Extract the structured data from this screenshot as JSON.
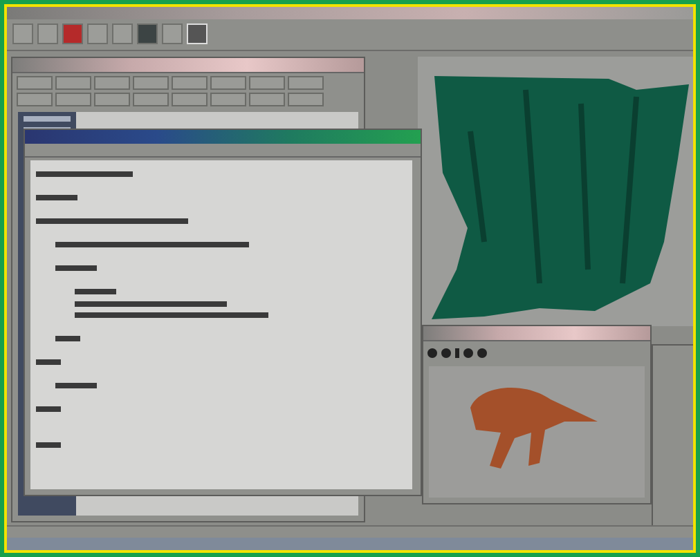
{
  "toolbar": {
    "buttons": [
      {
        "kind": "plain"
      },
      {
        "kind": "plain"
      },
      {
        "kind": "red"
      },
      {
        "kind": "plain"
      },
      {
        "kind": "plain"
      },
      {
        "kind": "dark"
      },
      {
        "kind": "plain"
      },
      {
        "kind": "boxed"
      }
    ]
  },
  "object_window": {
    "tabs": [
      {
        "kind": "tab"
      },
      {
        "kind": "tab"
      },
      {
        "kind": "tab"
      },
      {
        "kind": "tab"
      },
      {
        "kind": "tab"
      },
      {
        "kind": "tab"
      },
      {
        "kind": "tab"
      },
      {
        "kind": "tab"
      },
      {
        "kind": "tab"
      },
      {
        "kind": "tab"
      },
      {
        "kind": "tab"
      },
      {
        "kind": "tab"
      },
      {
        "kind": "tab"
      },
      {
        "kind": "tab"
      },
      {
        "kind": "tab"
      },
      {
        "kind": "tab"
      }
    ]
  },
  "script_editor": {
    "lines": [
      {
        "kind": "mid"
      },
      {
        "kind": "blank"
      },
      {
        "kind": "short"
      },
      {
        "kind": "blank"
      },
      {
        "kind": "long",
        "children": [
          {
            "kind": "blank"
          },
          {
            "kind": "xlong"
          },
          {
            "kind": "blank"
          },
          {
            "kind": "short",
            "children": [
              {
                "kind": "blank"
              },
              {
                "kind": "short"
              },
              {
                "kind": "long"
              },
              {
                "kind": "xlong"
              },
              {
                "kind": "blank"
              }
            ]
          },
          {
            "kind": "tiny"
          },
          {
            "kind": "blank"
          }
        ]
      },
      {
        "kind": "tiny",
        "children": [
          {
            "kind": "blank"
          },
          {
            "kind": "short"
          },
          {
            "kind": "blank"
          }
        ]
      },
      {
        "kind": "tiny"
      },
      {
        "kind": "blank"
      },
      {
        "kind": "blank"
      },
      {
        "kind": "tiny"
      }
    ]
  },
  "preview": {
    "buttons": [
      {
        "kind": "round"
      },
      {
        "kind": "round"
      },
      {
        "kind": "bar"
      },
      {
        "kind": "round"
      },
      {
        "kind": "round"
      }
    ]
  }
}
